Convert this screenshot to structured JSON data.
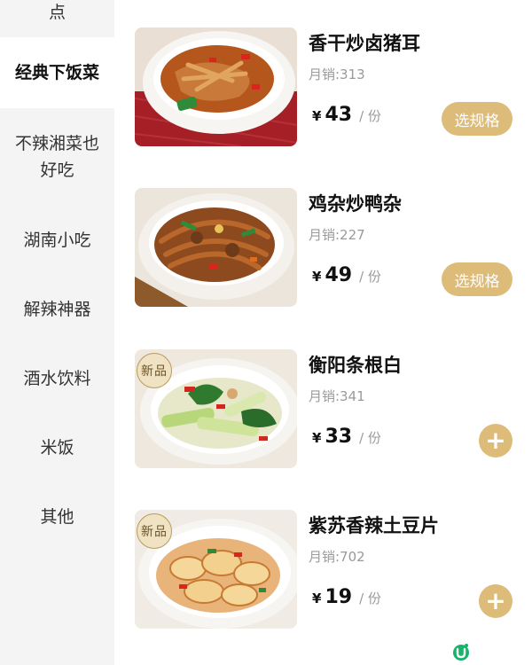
{
  "sidebar": {
    "items": [
      {
        "label": "点"
      },
      {
        "label": "经典下饭菜"
      },
      {
        "label": "不辣湘菜也好吃"
      },
      {
        "label": "湖南小吃"
      },
      {
        "label": "解辣神器"
      },
      {
        "label": "酒水饮料"
      },
      {
        "label": "米饭"
      },
      {
        "label": "其他"
      }
    ],
    "active_index": 1
  },
  "dishes": [
    {
      "name": "香干炒卤猪耳",
      "sales": "月销:313",
      "currency": "¥",
      "price": "43",
      "unit": "/ 份",
      "button": "选规格",
      "badge": ""
    },
    {
      "name": "鸡杂炒鸭杂",
      "sales": "月销:227",
      "currency": "¥",
      "price": "49",
      "unit": "/ 份",
      "button": "选规格",
      "badge": ""
    },
    {
      "name": "衡阳条根白",
      "sales": "月销:341",
      "currency": "¥",
      "price": "33",
      "unit": "/ 份",
      "button": "+",
      "badge": "新品"
    },
    {
      "name": "紫苏香辣土豆片",
      "sales": "月销:702",
      "currency": "¥",
      "price": "19",
      "unit": "/ 份",
      "button": "+",
      "badge": "新品"
    }
  ],
  "colors": {
    "accent": "#ddbb79",
    "sidebar_bg": "#f4f4f4",
    "muted_text": "#9a9a9a"
  },
  "icons": {
    "corner_logo": "u-logo-icon"
  }
}
